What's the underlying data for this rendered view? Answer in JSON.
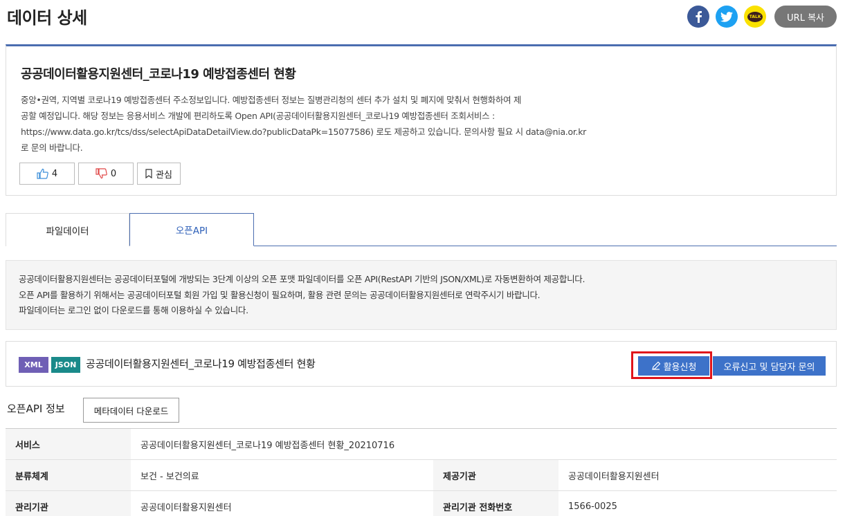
{
  "page": {
    "title": "데이터 상세"
  },
  "share": {
    "facebook_icon": "facebook-icon",
    "twitter_icon": "twitter-icon",
    "kakao_label": "TALK",
    "url_copy_label": "URL 복사"
  },
  "dataset": {
    "title": "공공데이터활용지원센터_코로나19 예방접종센터 현황",
    "description_lines": [
      "중앙•권역, 지역별 코로나19 예방접종센터 주소정보입니다. 예방접종센터 정보는 질병관리청의 센터 추가 설치 및 폐지에 맞춰서 현행화하여 제",
      "공할 예정입니다. 해당 정보는 응용서비스 개발에 편리하도록 Open API(공공데이터활용지원센터_코로나19 예방접종센터 조회서비스 :",
      "https://www.data.go.kr/tcs/dss/selectApiDataDetailView.do?publicDataPk=15077586) 로도 제공하고 있습니다. 문의사항 필요 시 data@nia.or.kr",
      "로 문의 바랍니다."
    ],
    "like_count": "4",
    "dislike_count": "0",
    "favorite_label": "관심"
  },
  "tabs": [
    {
      "label": "파일데이터",
      "active": false
    },
    {
      "label": "오픈API",
      "active": true
    }
  ],
  "info": {
    "lines": [
      "공공데이터활용지원센터는 공공데이터포털에 개방되는 3단계 이상의 오픈 포맷 파일데이터를 오픈 API(RestAPI 기반의 JSON/XML)로 자동변환하여 제공합니다.",
      "오픈 API를 활용하기 위해서는 공공데이터포털 회원 가입 및 활용신청이 필요하며, 활용 관련 문의는 공공데이터활용지원센터로 연락주시기 바랍니다.",
      "파일데이터는 로그인 없이 다운로드를 통해 이용하실 수 있습니다."
    ]
  },
  "api": {
    "badge_xml": "XML",
    "badge_json": "JSON",
    "name": "공공데이터활용지원센터_코로나19 예방접종센터 현황",
    "apply_label": "활용신청",
    "report_label": "오류신고 및 담당자 문의"
  },
  "api_info": {
    "section_title": "오픈API 정보",
    "meta_download_label": "메타데이터 다운로드",
    "rows": [
      {
        "k1": "서비스",
        "v1": "공공데이터활용지원센터_코로나19 예방접종센터 현황_20210716"
      },
      {
        "k1": "분류체계",
        "v1": "보건 - 보건의료",
        "k2": "제공기관",
        "v2": "공공데이터활용지원센터"
      },
      {
        "k1": "관리기관",
        "v1": "공공데이터활용지원센터",
        "k2": "관리기관 전화번호",
        "v2": "1566-0025"
      }
    ]
  },
  "colors": {
    "accent": "#4a6db0",
    "button_blue": "#3d72c9",
    "highlight_red": "#e0141a",
    "badge_xml": "#6f5fb5",
    "badge_json": "#1a8a8a"
  }
}
